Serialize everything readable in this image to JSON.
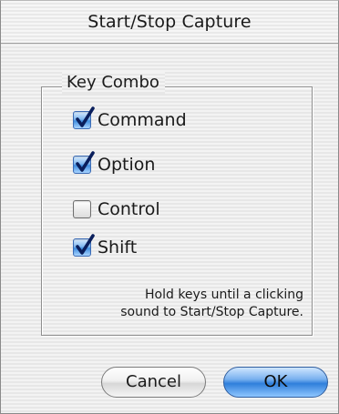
{
  "dialog": {
    "title": "Start/Stop Capture"
  },
  "group": {
    "legend": "Key Combo",
    "checkboxes": [
      {
        "label": "Command",
        "checked": true
      },
      {
        "label": "Option",
        "checked": true
      },
      {
        "label": "Control",
        "checked": false
      },
      {
        "label": "Shift",
        "checked": true
      }
    ],
    "hint_line1": "Hold keys until a clicking",
    "hint_line2": "sound to Start/Stop Capture."
  },
  "buttons": {
    "cancel_label": "Cancel",
    "ok_label": "OK"
  },
  "colors": {
    "accent": "#3f8ee0",
    "checkmark": "#0a1f5c"
  }
}
